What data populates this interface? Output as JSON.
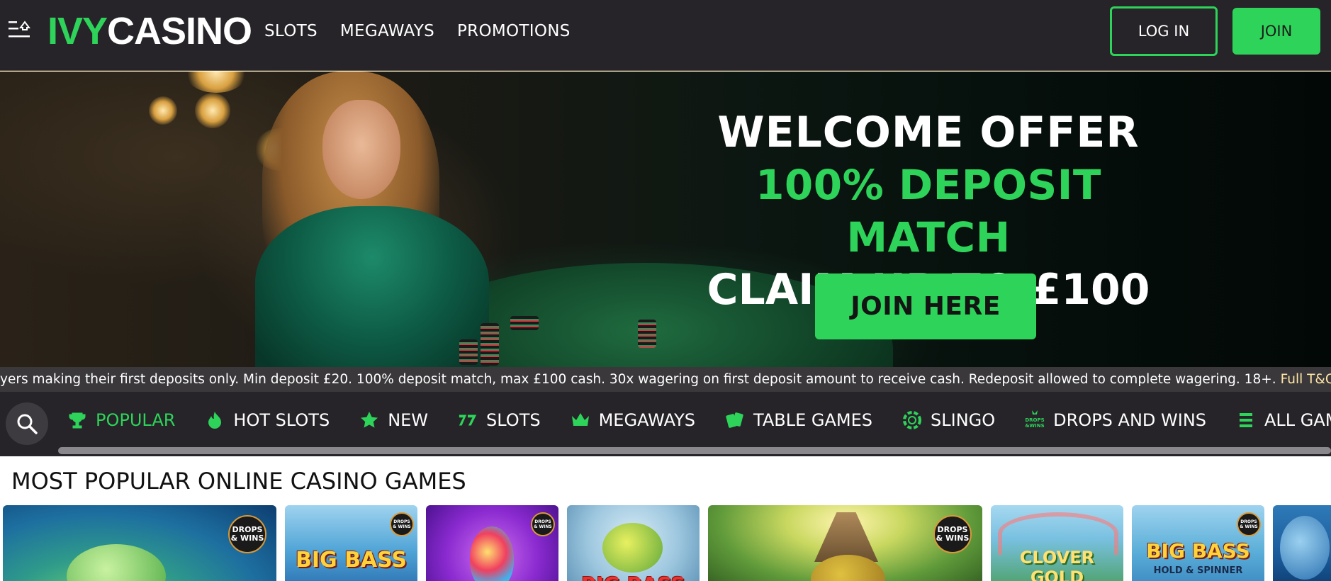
{
  "header": {
    "logo_part1": "IVY",
    "logo_part2": "CASINO",
    "nav": [
      "SLOTS",
      "MEGAWAYS",
      "PROMOTIONS"
    ],
    "login_label": "LOG IN",
    "join_label": "JOIN"
  },
  "hero": {
    "line1": "WELCOME OFFER",
    "line2": "100% DEPOSIT MATCH",
    "line3": "CLAIM UP TO £100",
    "cta_label": "JOIN HERE"
  },
  "terms": {
    "text": "New players making their first deposits only. Min deposit £20. 100% deposit match, max £100 cash. 30x wagering on first deposit amount to receive cash. Redeposit allowed to complete wagering. 18+.",
    "link": "Full T&Cs apply."
  },
  "categories": [
    {
      "label": "POPULAR",
      "icon": "trophy-icon",
      "active": true
    },
    {
      "label": "HOT SLOTS",
      "icon": "flame-icon",
      "active": false
    },
    {
      "label": "NEW",
      "icon": "star-icon",
      "active": false
    },
    {
      "label": "SLOTS",
      "icon": "sevens-icon",
      "active": false
    },
    {
      "label": "MEGAWAYS",
      "icon": "crown-icon",
      "active": false
    },
    {
      "label": "TABLE GAMES",
      "icon": "cards-icon",
      "active": false
    },
    {
      "label": "SLINGO",
      "icon": "chip-icon",
      "active": false
    },
    {
      "label": "DROPS AND WINS",
      "icon": "drops-wins-icon",
      "active": false
    },
    {
      "label": "ALL GAMES",
      "icon": "list-icon",
      "active": false
    }
  ],
  "section": {
    "title": "MOST POPULAR ONLINE CASINO GAMES"
  },
  "games": [
    {
      "title": "",
      "badge": "DROPS & WINS"
    },
    {
      "title": "BIG BASS",
      "badge": "DROPS & WINS"
    },
    {
      "title": "",
      "badge": "DROPS & WINS"
    },
    {
      "title": "BIG BASS",
      "badge": ""
    },
    {
      "title": "",
      "badge": "DROPS & WINS"
    },
    {
      "title": "CLOVER GOLD",
      "badge": ""
    },
    {
      "title": "BIG BASS",
      "subtitle": "HOLD & SPINNER",
      "badge": "DROPS & WINS"
    },
    {
      "title": "",
      "badge": ""
    }
  ],
  "colors": {
    "accent": "#2ed35a",
    "header_bg": "#262428",
    "terms_bg": "#3a383b"
  }
}
